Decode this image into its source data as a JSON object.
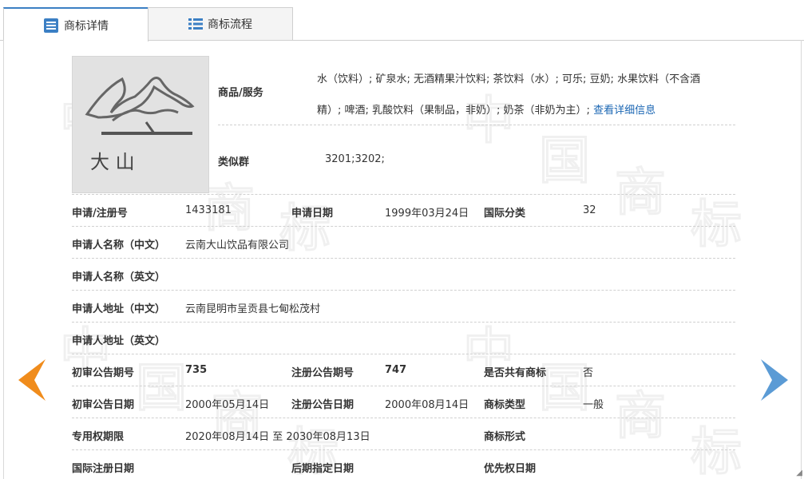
{
  "tabs": [
    {
      "label": "商标详情",
      "active": true
    },
    {
      "label": "商标流程",
      "active": false
    }
  ],
  "goods_services": {
    "label": "商品/服务",
    "line1": "水（饮料）; 矿泉水; 无酒精果汁饮料; 茶饮料（水）; 可乐; 豆奶; 水果饮料（不含酒",
    "line2": "精）; 啤酒; 乳酸饮料（果制品，非奶）; 奶茶（非奶为主）; ",
    "link": "查看详细信息"
  },
  "similar_group": {
    "label": "类似群",
    "value": "3201;3202;"
  },
  "logo": {
    "chars": "大  山"
  },
  "fields": {
    "reg_no": {
      "label": "申请/注册号",
      "value": "1433181"
    },
    "apply_date": {
      "label": "申请日期",
      "value": "1999年03月24日"
    },
    "intl_class": {
      "label": "国际分类",
      "value": "32"
    },
    "applicant_cn": {
      "label": "申请人名称（中文）",
      "value": "云南大山饮品有限公司"
    },
    "applicant_en": {
      "label": "申请人名称（英文）",
      "value": ""
    },
    "address_cn": {
      "label": "申请人地址（中文）",
      "value": "云南昆明市呈贡县七甸松茂村"
    },
    "address_en": {
      "label": "申请人地址（英文）",
      "value": ""
    },
    "prelim_issue": {
      "label": "初审公告期号",
      "value": "735"
    },
    "reg_issue": {
      "label": "注册公告期号",
      "value": "747"
    },
    "shared": {
      "label": "是否共有商标",
      "value": "否"
    },
    "prelim_date": {
      "label": "初审公告日期",
      "value": "2000年05月14日"
    },
    "reg_date": {
      "label": "注册公告日期",
      "value": "2000年08月14日"
    },
    "mark_type": {
      "label": "商标类型",
      "value": "一般"
    },
    "exclusive_period": {
      "label": "专用权期限",
      "value": "2020年08月14日 至 2030年08月13日"
    },
    "mark_form": {
      "label": "商标形式",
      "value": ""
    },
    "intl_reg_date": {
      "label": "国际注册日期",
      "value": ""
    },
    "later_designation": {
      "label": "后期指定日期",
      "value": ""
    },
    "priority_date": {
      "label": "优先权日期",
      "value": ""
    }
  },
  "watermark": [
    "中",
    "国",
    "商",
    "标"
  ],
  "colors": {
    "accent": "#3b7fc4",
    "link": "#1a66b3",
    "prev_arrow": "#f08c1c",
    "next_arrow": "#5b9bd5"
  }
}
